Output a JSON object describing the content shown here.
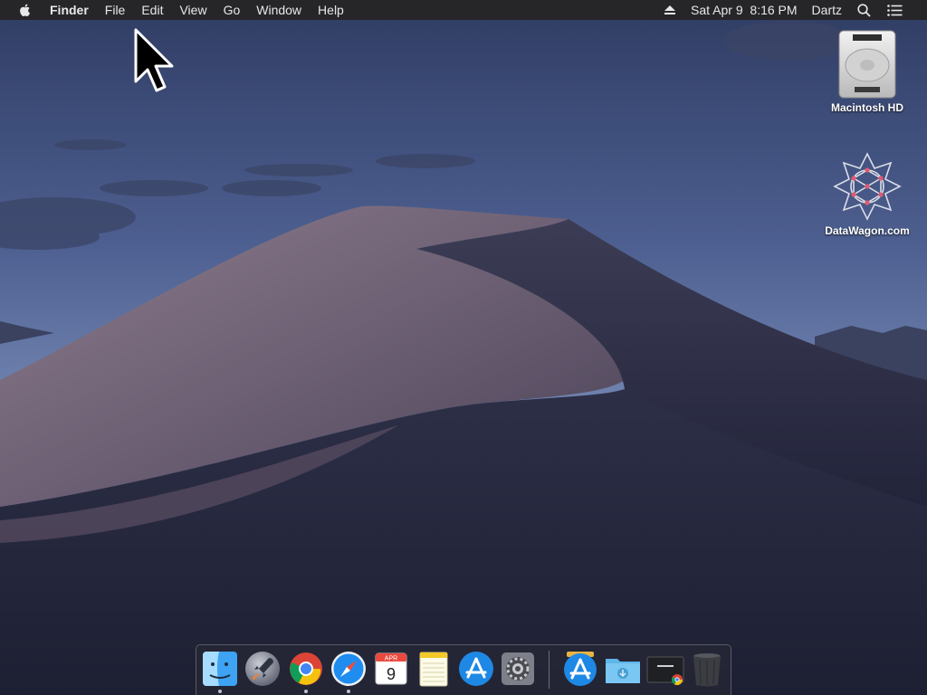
{
  "menubar": {
    "apple_icon": "apple-logo-icon",
    "app_name": "Finder",
    "menus": [
      "File",
      "Edit",
      "View",
      "Go",
      "Window",
      "Help"
    ],
    "eject_icon": "eject-icon",
    "datetime": "Sat Apr 9  8:16 PM",
    "user": "Dartz",
    "search_icon": "spotlight-search-icon",
    "notifications_icon": "notification-center-icon"
  },
  "desktop": {
    "icons": [
      {
        "label": "Macintosh HD",
        "icon": "hard-drive-icon"
      },
      {
        "label": "DataWagon.com",
        "icon": "network-volume-icon"
      }
    ]
  },
  "dock": {
    "items": [
      {
        "name": "finder",
        "icon": "finder-icon",
        "running": true
      },
      {
        "name": "launchpad",
        "icon": "launchpad-rocket-icon",
        "running": false
      },
      {
        "name": "chrome",
        "icon": "chrome-icon",
        "running": true
      },
      {
        "name": "safari",
        "icon": "safari-compass-icon",
        "running": true
      },
      {
        "name": "calendar",
        "icon": "calendar-icon",
        "month": "APR",
        "day": "9",
        "running": false
      },
      {
        "name": "notes",
        "icon": "notes-icon",
        "running": false
      },
      {
        "name": "app-store",
        "icon": "app-store-icon",
        "running": false
      },
      {
        "name": "system-preferences",
        "icon": "gear-icon",
        "running": false
      },
      {
        "name": "applications-folder",
        "icon": "app-store-icon",
        "running": false
      },
      {
        "name": "downloads-folder",
        "icon": "downloads-folder-icon",
        "running": false
      },
      {
        "name": "chrome-stack",
        "icon": "google-chrome-window-icon",
        "running": false
      },
      {
        "name": "trash",
        "icon": "trash-icon",
        "running": false
      }
    ]
  },
  "colors": {
    "sky_top": "#3a4a73",
    "sky_bottom": "#7185b0",
    "dune_light": "#7d6f80",
    "dune_dark": "#2b2d43",
    "menubar": "#262629"
  }
}
